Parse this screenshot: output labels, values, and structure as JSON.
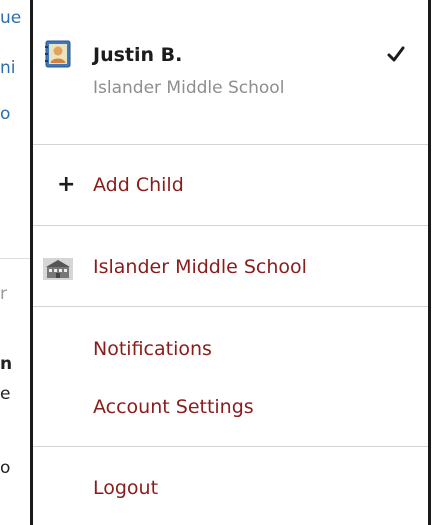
{
  "background": {
    "fragments": [
      "ue",
      "ni",
      "o",
      "r",
      "n",
      "e",
      "o"
    ]
  },
  "menu": {
    "child": {
      "name": "Justin B.",
      "school": "Islander Middle School",
      "icon": "contact-card-icon",
      "selected_icon": "checkmark-icon"
    },
    "add_child": {
      "icon": "plus-icon",
      "label": "Add Child"
    },
    "school_link": {
      "icon": "school-building-icon",
      "label": "Islander Middle School"
    },
    "notifications": {
      "label": "Notifications"
    },
    "account_settings": {
      "label": "Account Settings"
    },
    "logout": {
      "label": "Logout"
    }
  },
  "colors": {
    "link": "#8a1c1c",
    "muted": "#8e8e8e",
    "border": "#1a1a1a",
    "divider": "#d3d3d3"
  }
}
